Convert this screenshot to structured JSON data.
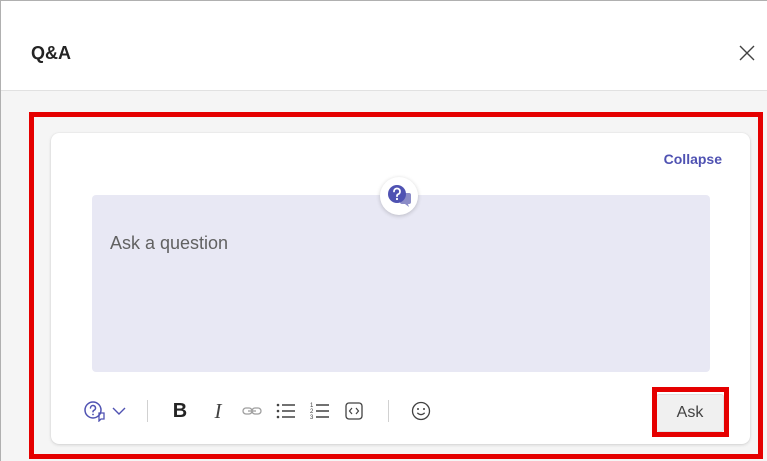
{
  "header": {
    "title": "Q&A",
    "close_icon": "close-icon"
  },
  "composer": {
    "collapse_label": "Collapse",
    "badge_icon": "qa-question-icon",
    "placeholder": "Ask a question",
    "ask_label": "Ask",
    "toolbar": [
      {
        "name": "question-type-icon"
      },
      {
        "name": "chevron-down-icon"
      },
      {
        "name": "bold-icon",
        "glyph": "B"
      },
      {
        "name": "italic-icon",
        "glyph": "I"
      },
      {
        "name": "link-icon"
      },
      {
        "name": "bulleted-list-icon"
      },
      {
        "name": "numbered-list-icon"
      },
      {
        "name": "code-snippet-icon"
      },
      {
        "name": "emoji-icon"
      }
    ]
  },
  "colors": {
    "accent": "#4f52b2",
    "highlight": "#e50000",
    "input_bg": "#e8e8f4"
  }
}
